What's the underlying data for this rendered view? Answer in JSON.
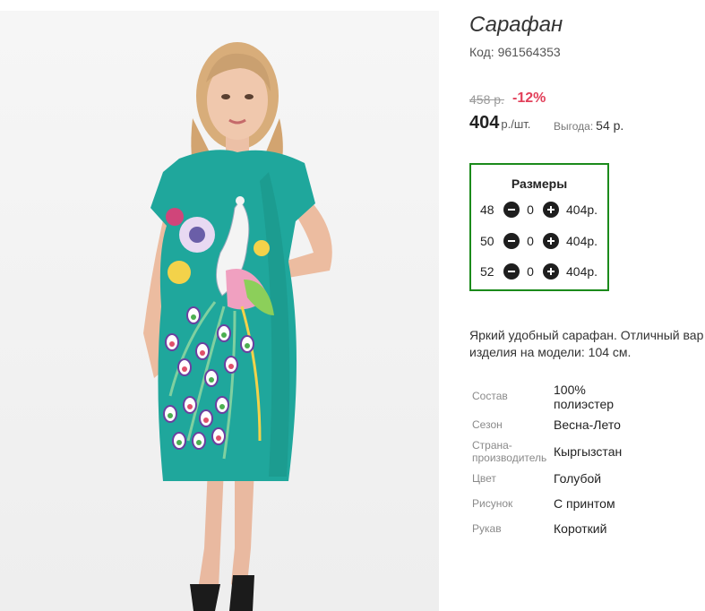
{
  "product": {
    "title": "Сарафан",
    "code_label": "Код:",
    "code": "961564353"
  },
  "price": {
    "old": "458 р.",
    "discount": "-12%",
    "current": "404",
    "unit": "р./шт.",
    "benefit_label": "Выгода:",
    "benefit_value": "54 р."
  },
  "sizes": {
    "title": "Размеры",
    "rows": [
      {
        "size": "48",
        "qty": "0",
        "price": "404р."
      },
      {
        "size": "50",
        "qty": "0",
        "price": "404р."
      },
      {
        "size": "52",
        "qty": "0",
        "price": "404р."
      }
    ]
  },
  "description": {
    "line1": "Яркий удобный сарафан. Отличный вар",
    "line2": "изделия на модели: 104 см."
  },
  "specs": [
    {
      "label": "Состав",
      "value_line1": "100%",
      "value_line2": "полиэстер"
    },
    {
      "label": "Сезон",
      "value": "Весна-Лето"
    },
    {
      "label_line1": "Страна-",
      "label_line2": "производитель",
      "value": "Кыргызстан"
    },
    {
      "label": "Цвет",
      "value": "Голубой"
    },
    {
      "label": "Рисунок",
      "value": "С принтом"
    },
    {
      "label": "Рукав",
      "value": "Короткий"
    }
  ],
  "icons": {
    "minus": "minus-circle-icon",
    "plus": "plus-circle-icon"
  },
  "colors": {
    "dress": "#1fa79c",
    "discount": "#e2405a",
    "sizes_border": "#1b8a1b"
  }
}
